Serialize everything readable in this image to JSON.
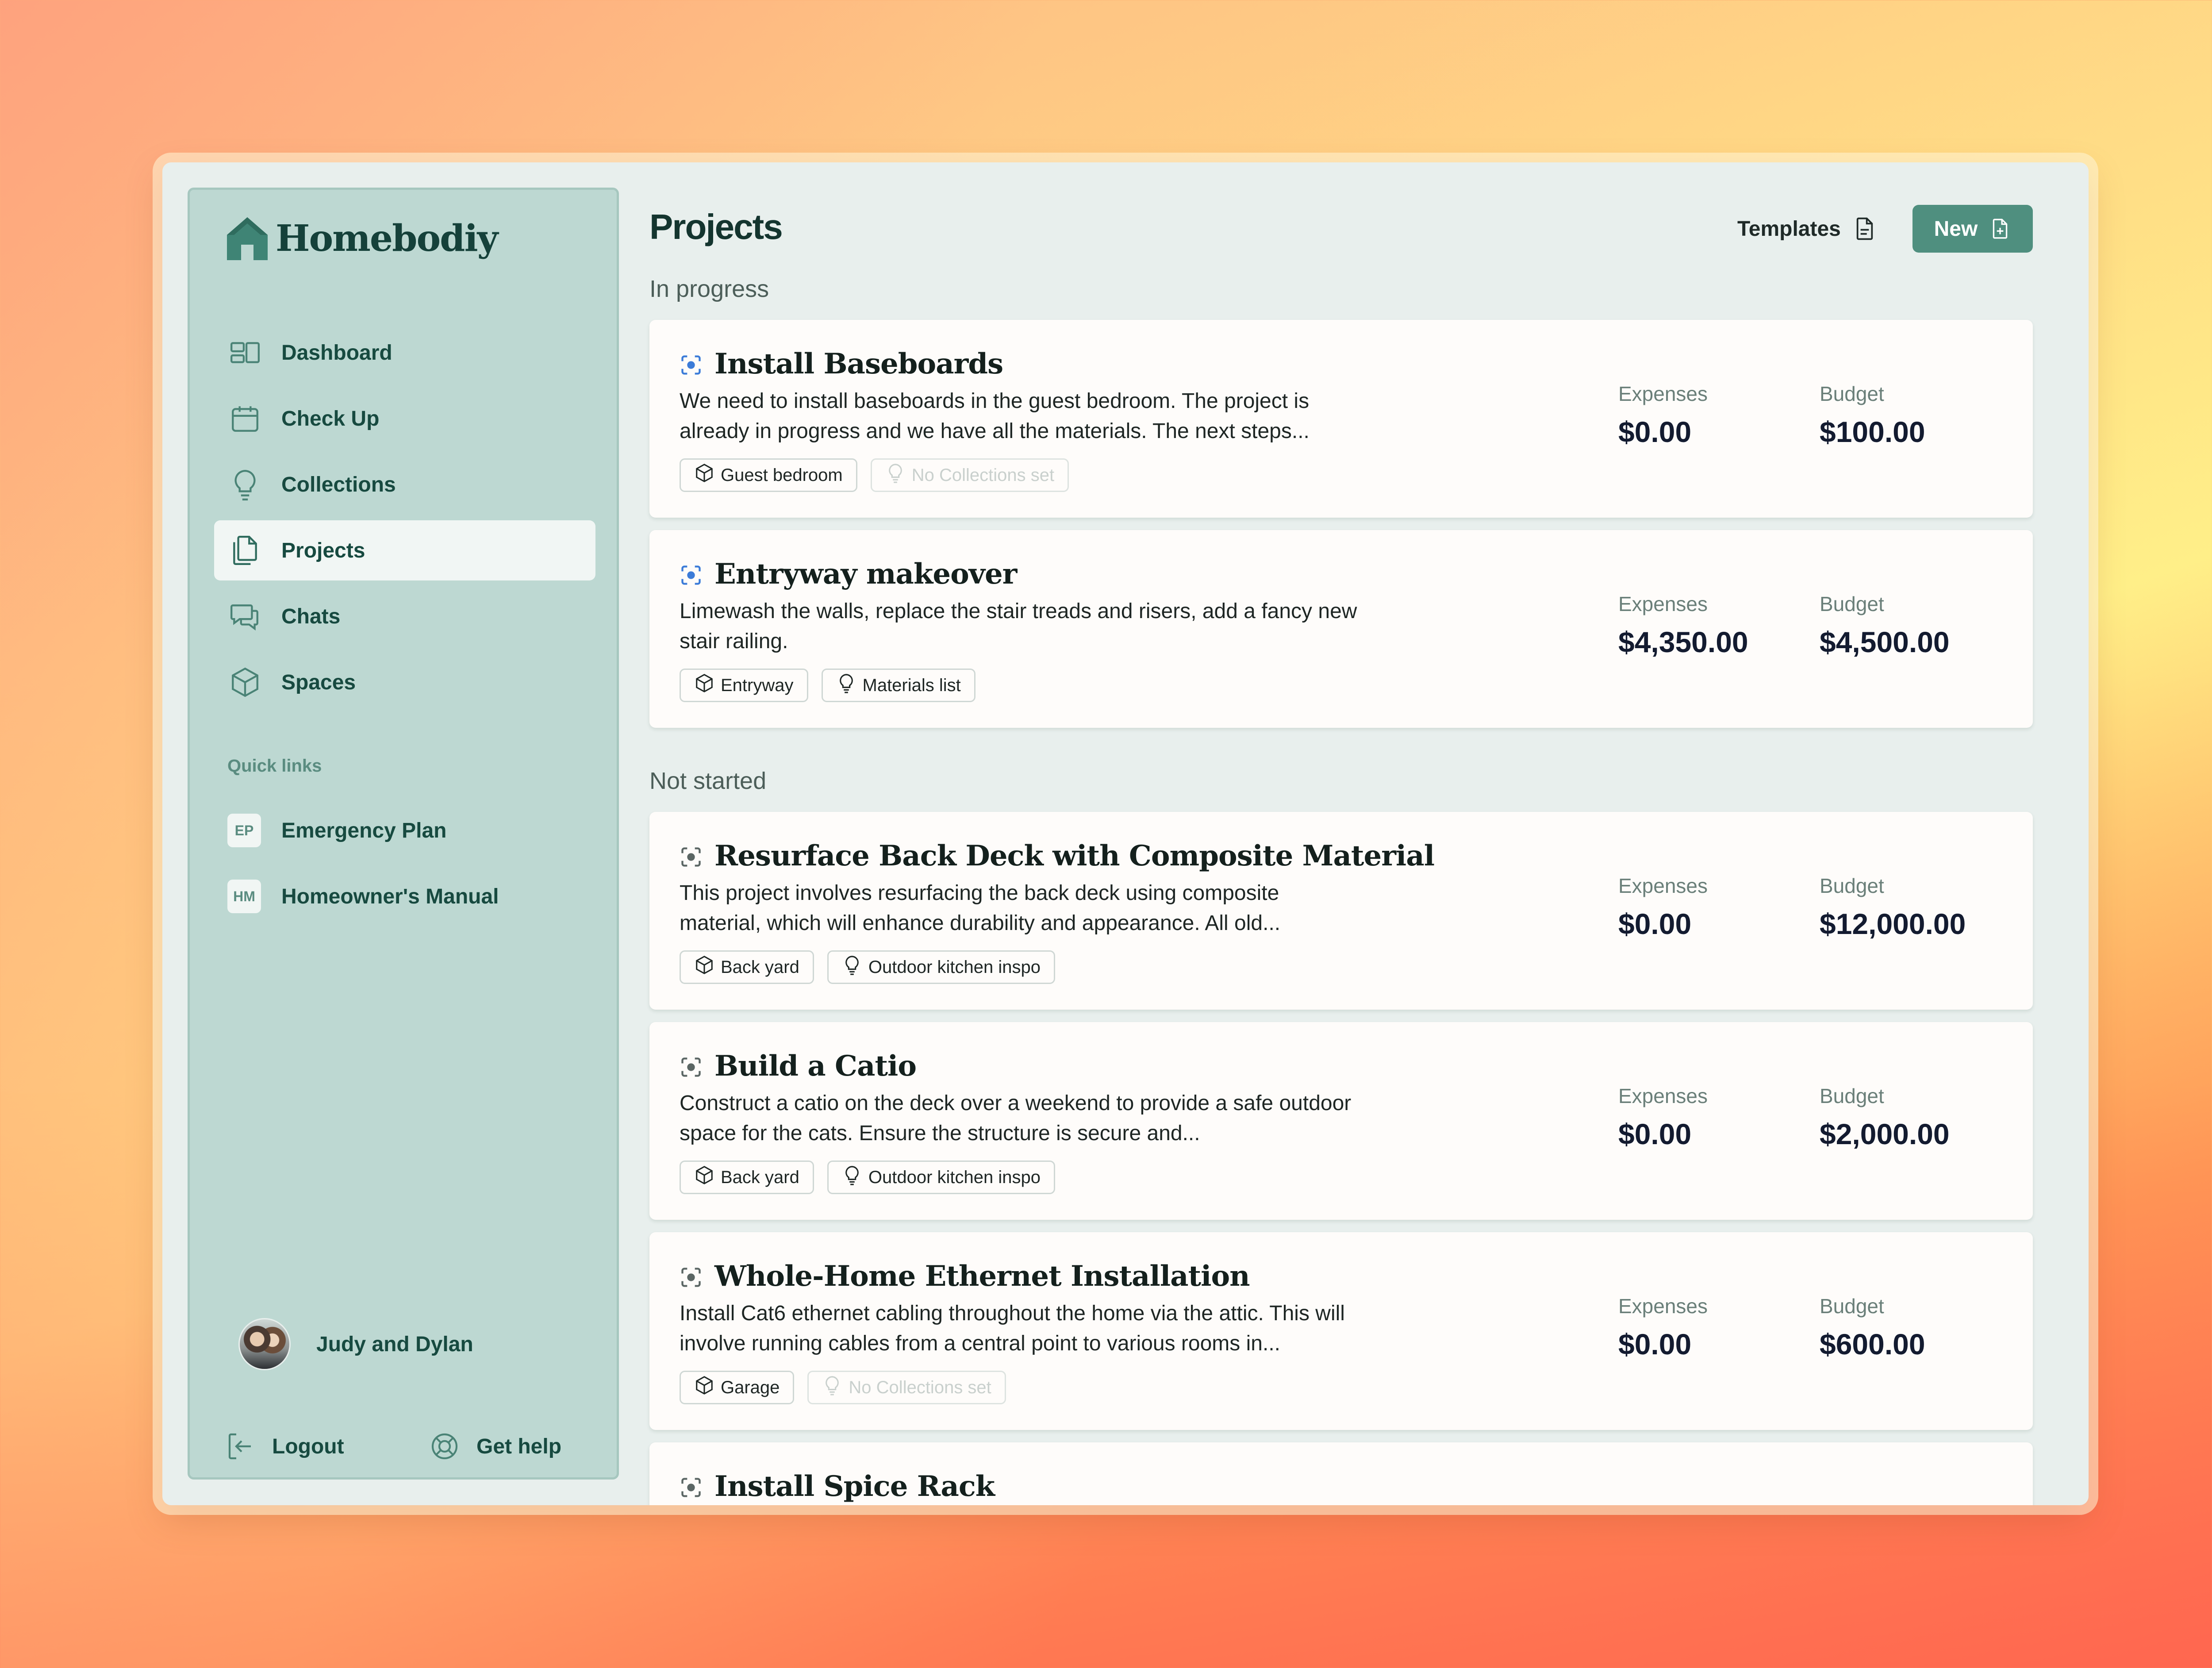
{
  "app": {
    "name": "Homebodiy"
  },
  "sidebar": {
    "nav": [
      {
        "label": "Dashboard",
        "icon": "dashboard-icon",
        "active": false
      },
      {
        "label": "Check Up",
        "icon": "calendar-icon",
        "active": false
      },
      {
        "label": "Collections",
        "icon": "lightbulb-icon",
        "active": false
      },
      {
        "label": "Projects",
        "icon": "documents-icon",
        "active": true
      },
      {
        "label": "Chats",
        "icon": "chat-icon",
        "active": false
      },
      {
        "label": "Spaces",
        "icon": "cube-icon",
        "active": false
      }
    ],
    "quick_links_title": "Quick links",
    "quick_links": [
      {
        "badge": "EP",
        "label": "Emergency Plan"
      },
      {
        "badge": "HM",
        "label": "Homeowner's Manual"
      }
    ],
    "user": {
      "name": "Judy and Dylan"
    },
    "logout_label": "Logout",
    "help_label": "Get help"
  },
  "main": {
    "title": "Projects",
    "templates_label": "Templates",
    "new_label": "New",
    "sections": [
      {
        "label": "In progress"
      },
      {
        "label": "Not started"
      }
    ],
    "expenses_label": "Expenses",
    "budget_label": "Budget",
    "projects": [
      {
        "title": "Install Baseboards",
        "status": "in-progress",
        "description": "We need to install baseboards in the guest bedroom. The project is already in progress and we have all the materials. The next steps...",
        "space": "Guest bedroom",
        "collection": "No Collections set",
        "collection_empty": true,
        "expenses": "$0.00",
        "budget": "$100.00"
      },
      {
        "title": "Entryway makeover",
        "status": "in-progress",
        "description": "Limewash the walls, replace the stair treads and risers, add a fancy new stair railing.",
        "space": "Entryway",
        "collection": "Materials list",
        "collection_empty": false,
        "expenses": "$4,350.00",
        "budget": "$4,500.00"
      },
      {
        "title": "Resurface Back Deck with Composite Material",
        "status": "not-started",
        "description": "This project involves resurfacing the back deck using composite material, which will enhance durability and appearance. All old...",
        "space": "Back yard",
        "collection": "Outdoor kitchen inspo",
        "collection_empty": false,
        "expenses": "$0.00",
        "budget": "$12,000.00"
      },
      {
        "title": "Build a Catio",
        "status": "not-started",
        "description": "Construct a catio on the deck over a weekend to provide a safe outdoor space for the cats. Ensure the structure is secure and...",
        "space": "Back yard",
        "collection": "Outdoor kitchen inspo",
        "collection_empty": false,
        "expenses": "$0.00",
        "budget": "$2,000.00"
      },
      {
        "title": "Whole-Home Ethernet Installation",
        "status": "not-started",
        "description": "Install Cat6 ethernet cabling throughout the home via the attic. This will involve running cables from a central point to various rooms in...",
        "space": "Garage",
        "collection": "No Collections set",
        "collection_empty": true,
        "expenses": "$0.00",
        "budget": "$600.00"
      },
      {
        "title": "Install Spice Rack",
        "status": "not-started"
      }
    ]
  },
  "colors": {
    "accent": "#4f8f7f",
    "sidebar_bg": "#bdd8d2",
    "in_progress": "#3b7bd8",
    "not_started": "#5b6664"
  }
}
